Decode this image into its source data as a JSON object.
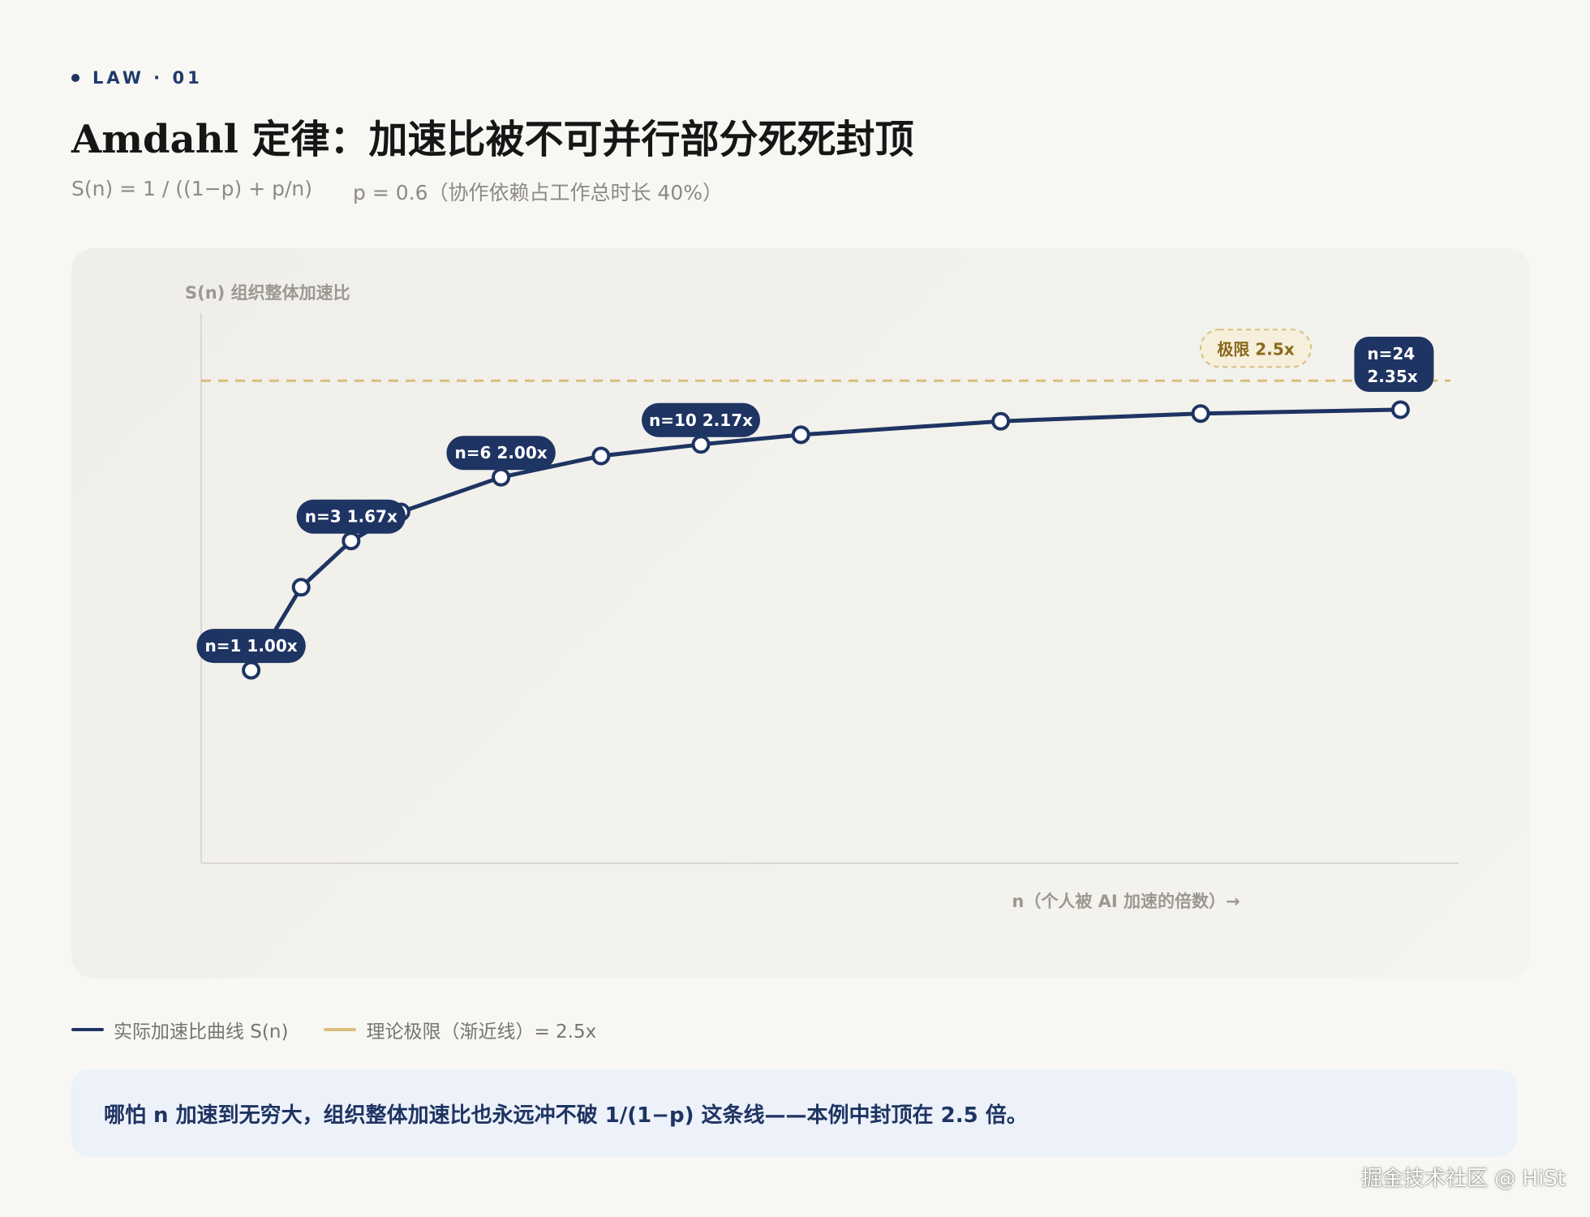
{
  "header": {
    "kicker": "LAW · 01",
    "title": "Amdahl 定律：加速比被不可并行部分死死封顶",
    "formula": "S(n) = 1 / ((1−p) + p/n)",
    "param": "p = 0.6（协作依赖占工作总时长 40%）"
  },
  "legend": {
    "actual": "实际加速比曲线 S(n)",
    "limit": "理论极限（渐近线）= 2.5x"
  },
  "note": "哪怕 n 加速到无穷大，组织整体加速比也永远冲不破 1/(1−p) 这条线——本例中封顶在 2.5 倍。",
  "watermark": "掘金技术社区 @ HiSt",
  "colors": {
    "line": "#1e3462",
    "limit": "#d8bf7c",
    "limit_text": "#8a6a1c",
    "point_fill": "#ffffff"
  },
  "chart_data": {
    "type": "line",
    "ylabel": "S(n) 组织整体加速比",
    "xlabel": "n（个人被 AI 加速的倍数）→",
    "xlim": [
      0,
      25
    ],
    "ylim": [
      0,
      2.85
    ],
    "grid": false,
    "series": [
      {
        "x": [
          1,
          2,
          3,
          4,
          6,
          8,
          10,
          12,
          16,
          20,
          24
        ],
        "values": [
          1.0,
          1.43,
          1.67,
          1.82,
          2.0,
          2.11,
          2.17,
          2.22,
          2.29,
          2.33,
          2.35
        ]
      }
    ],
    "asymptote": {
      "value": 2.5,
      "label": "极限 2.5x"
    },
    "annotations": [
      {
        "x": 1,
        "y": 1.0,
        "label": "n=1 1.00x"
      },
      {
        "x": 3,
        "y": 1.67,
        "label": "n=3 1.67x"
      },
      {
        "x": 6,
        "y": 2.0,
        "label": "n=6 2.00x"
      },
      {
        "x": 10,
        "y": 2.17,
        "label": "n=10 2.17x"
      },
      {
        "x": 24,
        "y": 2.35,
        "label": [
          "n=24",
          "2.35x"
        ]
      }
    ]
  }
}
